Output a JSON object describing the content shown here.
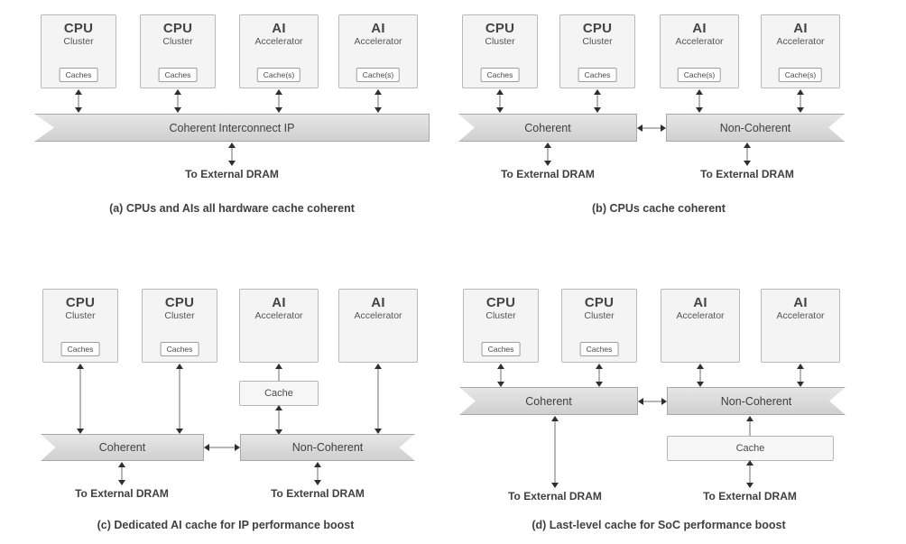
{
  "figure": {
    "background": "#ffffff",
    "box_fill": "#f4f4f4",
    "ribbon_fill": "#dcdcdc",
    "line_color": "#6d6d6d",
    "text_color": "#3f3f3f"
  },
  "labels": {
    "cpu": "CPU",
    "cluster": "Cluster",
    "ai": "AI",
    "accelerator": "Accelerator",
    "caches": "Caches",
    "caches_s": "Cache(s)",
    "cache": "Cache",
    "coherent_interconnect_ip": "Coherent Interconnect IP",
    "coherent": "Coherent",
    "non_coherent": "Non-Coherent",
    "to_external_dram": "To External DRAM"
  },
  "panels": [
    {
      "id": "a",
      "caption": "(a) CPUs and AIs all hardware cache coherent",
      "blocks": [
        {
          "title": "CPU",
          "subtitle": "Cluster",
          "cache": "Caches"
        },
        {
          "title": "CPU",
          "subtitle": "Cluster",
          "cache": "Caches"
        },
        {
          "title": "AI",
          "subtitle": "Accelerator",
          "cache": "Cache(s)"
        },
        {
          "title": "AI",
          "subtitle": "Accelerator",
          "cache": "Cache(s)"
        }
      ],
      "interconnects": [
        {
          "label": "Coherent Interconnect IP"
        }
      ],
      "dram": [
        "To External DRAM"
      ]
    },
    {
      "id": "b",
      "caption": "(b) CPUs cache coherent",
      "blocks": [
        {
          "title": "CPU",
          "subtitle": "Cluster",
          "cache": "Caches"
        },
        {
          "title": "CPU",
          "subtitle": "Cluster",
          "cache": "Caches"
        },
        {
          "title": "AI",
          "subtitle": "Accelerator",
          "cache": "Cache(s)"
        },
        {
          "title": "AI",
          "subtitle": "Accelerator",
          "cache": "Cache(s)"
        }
      ],
      "interconnects": [
        {
          "label": "Coherent"
        },
        {
          "label": "Non-Coherent"
        }
      ],
      "dram": [
        "To External DRAM",
        "To External DRAM"
      ]
    },
    {
      "id": "c",
      "caption": "(c) Dedicated AI cache for IP performance boost",
      "blocks": [
        {
          "title": "CPU",
          "subtitle": "Cluster",
          "cache": "Caches"
        },
        {
          "title": "CPU",
          "subtitle": "Cluster",
          "cache": "Caches"
        },
        {
          "title": "AI",
          "subtitle": "Accelerator",
          "cache": ""
        },
        {
          "title": "AI",
          "subtitle": "Accelerator",
          "cache": ""
        }
      ],
      "mid_cache": "Cache",
      "interconnects": [
        {
          "label": "Coherent"
        },
        {
          "label": "Non-Coherent"
        }
      ],
      "dram": [
        "To External DRAM",
        "To External DRAM"
      ]
    },
    {
      "id": "d",
      "caption": "(d) Last-level cache for SoC performance boost",
      "blocks": [
        {
          "title": "CPU",
          "subtitle": "Cluster",
          "cache": "Caches"
        },
        {
          "title": "CPU",
          "subtitle": "Cluster",
          "cache": "Caches"
        },
        {
          "title": "AI",
          "subtitle": "Accelerator",
          "cache": ""
        },
        {
          "title": "AI",
          "subtitle": "Accelerator",
          "cache": ""
        }
      ],
      "llc_cache": "Cache",
      "interconnects": [
        {
          "label": "Coherent"
        },
        {
          "label": "Non-Coherent"
        }
      ],
      "dram": [
        "To External DRAM",
        "To External DRAM"
      ]
    }
  ]
}
